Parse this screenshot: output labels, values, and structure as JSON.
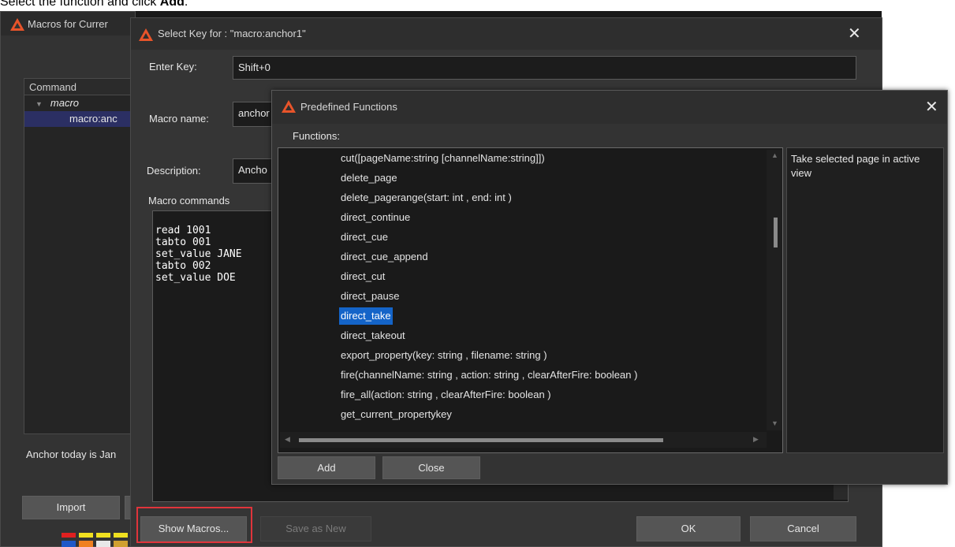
{
  "caption": {
    "prefix": "Select the function and click ",
    "bold": "Add",
    "suffix": "."
  },
  "macros_window": {
    "title": "Macros for Currer",
    "command_header": "Command",
    "tree": {
      "group": "macro",
      "item": "macro:anc"
    },
    "anchor_text": "Anchor today is Jan",
    "import_label": "Import"
  },
  "select_key_window": {
    "title": "Select Key for : \"macro:anchor1\"",
    "enter_key_label": "Enter Key:",
    "enter_key_value": "Shift+0",
    "macro_name_label": "Macro name:",
    "macro_name_value": "anchor",
    "description_label": "Description:",
    "description_value": "Ancho",
    "macro_commands_label": "Macro commands",
    "commands": [
      "read 1001",
      "tabto 001",
      "set_value JANE",
      "tabto 002",
      "set_value DOE"
    ],
    "show_macros_label": "Show Macros...",
    "save_as_new_label": "Save as New",
    "ok_label": "OK",
    "cancel_label": "Cancel"
  },
  "predefined_functions_window": {
    "title": "Predefined Functions",
    "functions_label": "Functions:",
    "functions": [
      "cut([pageName:string [channelName:string]])",
      "delete_page",
      "delete_pagerange(start: int , end: int )",
      "direct_continue",
      "direct_cue",
      "direct_cue_append",
      "direct_cut",
      "direct_pause",
      "direct_take",
      "direct_takeout",
      "export_property(key: string , filename: string )",
      "fire(channelName: string , action: string , clearAfterFire: boolean )",
      "fire_all(action: string , clearAfterFire: boolean )",
      "get_current_propertykey"
    ],
    "selected_function": "direct_take",
    "description": "Take selected page in active view",
    "add_label": "Add",
    "close_label": "Close"
  },
  "colors": {
    "accent_selection": "#1464c8",
    "highlight_box": "#e0343b",
    "logo_orange": "#e8542a"
  },
  "icons": {
    "app_logo": "viz-logo-icon",
    "close": "close-icon",
    "tree_expand": "triangle-down-icon"
  }
}
